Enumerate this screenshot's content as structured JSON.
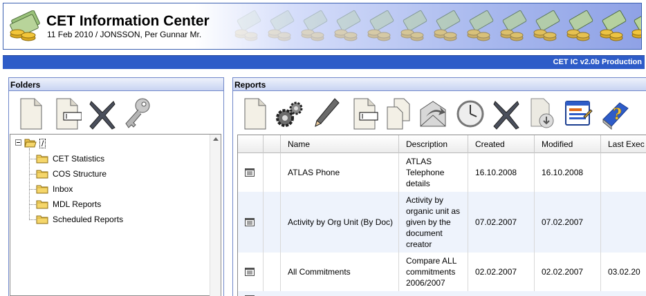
{
  "app": {
    "title": "CET Information Center",
    "subtitle": "11 Feb 2010 / JONSSON, Per Gunnar Mr.",
    "version": "CET IC v2.0b Production"
  },
  "folders": {
    "title": "Folders",
    "toolbar": [
      {
        "name": "new-folder-button",
        "icon": "new-document-icon"
      },
      {
        "name": "rename-folder-button",
        "icon": "rename-document-icon"
      },
      {
        "name": "delete-folder-button",
        "icon": "delete-x-icon"
      },
      {
        "name": "folder-permissions-button",
        "icon": "key-icon"
      }
    ],
    "tree": {
      "root": "/",
      "items": [
        {
          "label": "CET Statistics"
        },
        {
          "label": "COS Structure"
        },
        {
          "label": "Inbox"
        },
        {
          "label": "MDL Reports"
        },
        {
          "label": "Scheduled Reports"
        }
      ]
    }
  },
  "reports": {
    "title": "Reports",
    "toolbar": [
      {
        "name": "new-report-button",
        "icon": "new-document-icon"
      },
      {
        "name": "run-report-button",
        "icon": "gears-icon"
      },
      {
        "name": "edit-report-button",
        "icon": "pencil-icon"
      },
      {
        "name": "rename-report-button",
        "icon": "rename-document-icon"
      },
      {
        "name": "copy-report-button",
        "icon": "copy-documents-icon"
      },
      {
        "name": "send-report-button",
        "icon": "envelope-arrow-icon"
      },
      {
        "name": "schedule-report-button",
        "icon": "clock-icon"
      },
      {
        "name": "delete-report-button",
        "icon": "delete-x-icon"
      },
      {
        "name": "download-report-button",
        "icon": "download-document-icon"
      },
      {
        "name": "report-properties-button",
        "icon": "window-edit-icon"
      },
      {
        "name": "help-button",
        "icon": "help-book-icon"
      }
    ],
    "columns": [
      "",
      "",
      "Name",
      "Description",
      "Created",
      "Modified",
      "Last Exec"
    ],
    "rows": [
      {
        "name": "ATLAS Phone",
        "description": "ATLAS Telephone details",
        "created": "16.10.2008",
        "modified": "16.10.2008",
        "last_exec": ""
      },
      {
        "name": "Activity by Org Unit (By Doc)",
        "description": "Activity by organic unit as given by the document creator",
        "created": "07.02.2007",
        "modified": "07.02.2007",
        "last_exec": ""
      },
      {
        "name": "All Commitments",
        "description": "Compare ALL commitments 2006/2007",
        "created": "02.02.2007",
        "modified": "02.02.2007",
        "last_exec": "03.02.20"
      }
    ]
  },
  "colors": {
    "accent_bar": "#2e5cc8",
    "panel_border": "#6f86c9",
    "alt_row": "#eef3fc"
  }
}
